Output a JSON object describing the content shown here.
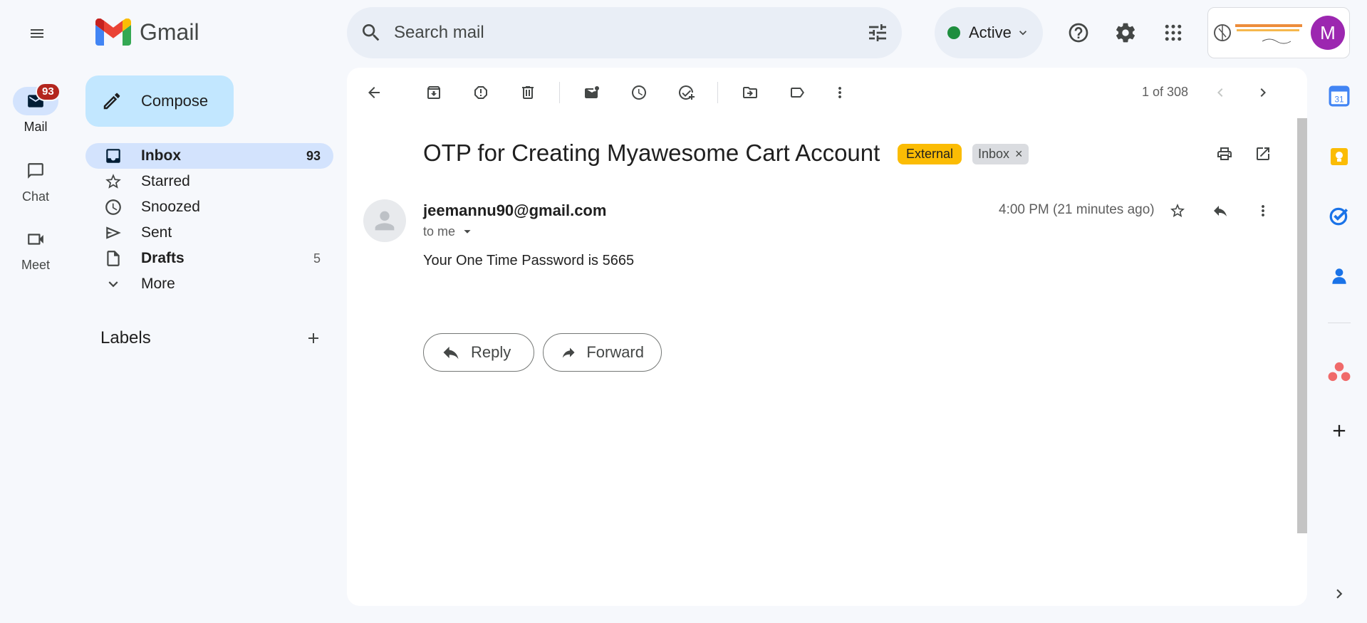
{
  "header": {
    "menu_icon": "hamburger-menu-icon",
    "app_name": "Gmail",
    "search_placeholder": "Search mail",
    "status_label": "Active",
    "status_color": "#1e8e3e",
    "avatar_initial": "M",
    "avatar_color": "#9c27b0"
  },
  "rail": {
    "items": [
      {
        "label": "Mail",
        "icon": "mail-icon",
        "badge": "93"
      },
      {
        "label": "Chat",
        "icon": "chat-icon"
      },
      {
        "label": "Meet",
        "icon": "video-icon"
      }
    ]
  },
  "sidebar": {
    "compose_label": "Compose",
    "items": [
      {
        "label": "Inbox",
        "count": "93",
        "icon": "inbox-icon"
      },
      {
        "label": "Starred",
        "count": "",
        "icon": "star-icon"
      },
      {
        "label": "Snoozed",
        "count": "",
        "icon": "clock-icon"
      },
      {
        "label": "Sent",
        "count": "",
        "icon": "send-icon"
      },
      {
        "label": "Drafts",
        "count": "5",
        "icon": "draft-icon"
      },
      {
        "label": "More",
        "count": "",
        "icon": "chevron-down-icon"
      }
    ],
    "labels_heading": "Labels"
  },
  "toolbar": {
    "pagination": "1 of 308"
  },
  "email": {
    "subject": "OTP for Creating Myawesome Cart Account",
    "chips": {
      "external": "External",
      "inbox": "Inbox",
      "remove": "×"
    },
    "sender": "jeemannu90@gmail.com",
    "recipient": "to me",
    "time": "4:00 PM (21 minutes ago)",
    "body": "Your One Time Password is 5665",
    "reply_label": "Reply",
    "forward_label": "Forward"
  },
  "colors": {
    "accent": "#c2e7ff",
    "active_nav": "#d3e3fd",
    "external_chip": "#fbbc04",
    "badge": "#b3261e"
  }
}
